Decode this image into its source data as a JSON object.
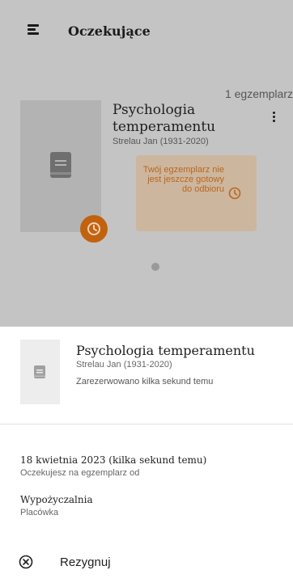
{
  "header": {
    "title": "Oczekujące",
    "menu_icon": "hamburger-menu-icon"
  },
  "list": {
    "copies_count": "1 egzemplarz"
  },
  "card": {
    "title": "Psychologia temperamentu",
    "author": "Strelau Jan (1931-2020)",
    "status_text": "Twój egzemplarz nie jest jeszcze gotowy do odbioru",
    "icons": [
      "book-icon",
      "clock-icon",
      "more-vertical-icon"
    ]
  },
  "pager": {
    "current_page": 1,
    "total_pages": 1
  },
  "sheet": {
    "title": "Psychologia temperamentu",
    "author": "Strelau Jan (1931-2020)",
    "reserved_text": "Zarezerwowano kilka sekund temu",
    "wait_date": "18 kwietnia 2023 (kilka sekund temu)",
    "wait_desc": "Oczekujesz na egzemplarz od",
    "branch_name": "Wypożyczalnia",
    "branch_label": "Placówka",
    "cancel_label": "Rezygnuj",
    "cancel_icon": "cancel-circle-icon"
  },
  "colors": {
    "accent": "#c2620f",
    "status_bg": "#cdb69e",
    "status_text": "#b8671f",
    "scrim": "#c4c4c4",
    "sheet_bg": "#ffffff"
  }
}
